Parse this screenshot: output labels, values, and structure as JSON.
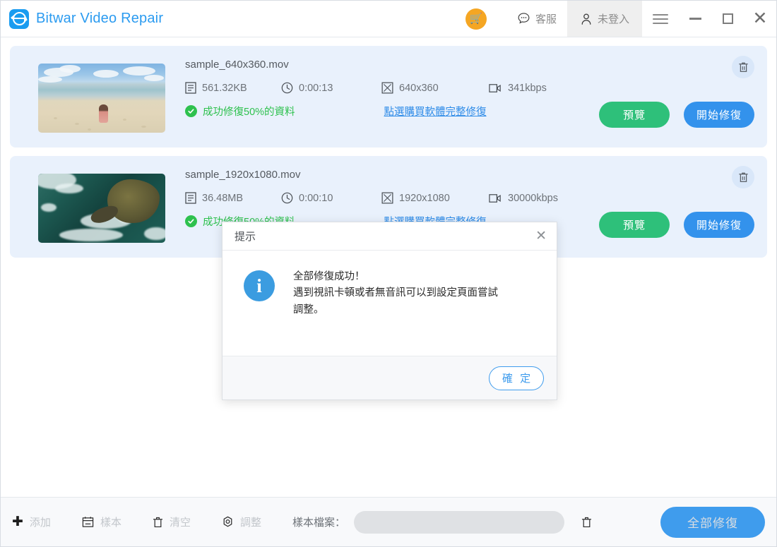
{
  "app": {
    "title": "Bitwar Video Repair",
    "logo_icon": "bitwar-logo-icon"
  },
  "header": {
    "cart_icon": "shopping-cart-icon",
    "support": {
      "icon": "chat-bubble-icon",
      "label": "客服"
    },
    "account": {
      "icon": "person-icon",
      "label": "未登入"
    },
    "menu_icon": "hamburger-menu-icon",
    "minimize_icon": "minimize-icon",
    "maximize_icon": "maximize-icon",
    "close_icon": "close-icon"
  },
  "files": [
    {
      "name": "sample_640x360.mov",
      "size": "561.32KB",
      "duration": "0:00:13",
      "resolution": "640x360",
      "bitrate": "341kbps",
      "status": "成功修復50%的資料",
      "buy_link": "點選購買軟體完整修復",
      "preview_label": "預覽",
      "repair_label": "開始修復",
      "delete_icon": "trash-icon",
      "size_icon": "file-size-icon",
      "duration_icon": "clock-icon",
      "resolution_icon": "resolution-icon",
      "bitrate_icon": "bitrate-camera-icon",
      "status_icon": "check-circle-icon",
      "thumbnail": "beach-photo"
    },
    {
      "name": "sample_1920x1080.mov",
      "size": "36.48MB",
      "duration": "0:00:10",
      "resolution": "1920x1080",
      "bitrate": "30000kbps",
      "status": "成功修復50%的資料",
      "buy_link": "點選購買軟體完整修復",
      "preview_label": "預覽",
      "repair_label": "開始修復",
      "delete_icon": "trash-icon",
      "size_icon": "file-size-icon",
      "duration_icon": "clock-icon",
      "resolution_icon": "resolution-icon",
      "bitrate_icon": "bitrate-camera-icon",
      "status_icon": "check-circle-icon",
      "thumbnail": "ocean-rock-photo"
    }
  ],
  "footer": {
    "add": {
      "icon": "plus-icon",
      "label": "添加"
    },
    "sample": {
      "icon": "sample-file-icon",
      "label": "樣本"
    },
    "clear": {
      "icon": "trash-icon",
      "label": "清空"
    },
    "adjust": {
      "icon": "gear-icon",
      "label": "調整"
    },
    "sample_file_label": "樣本檔案：",
    "sample_file_value": "",
    "sample_file_placeholder": "",
    "sample_delete_icon": "trash-icon",
    "repair_all_label": "全部修復"
  },
  "dialog": {
    "title": "提示",
    "close_icon": "close-icon",
    "info_icon": "info-icon",
    "info_glyph": "i",
    "message": "全部修復成功！\n遇到視訊卡頓或者無音訊可以到設定頁面嘗試調整。",
    "ok_label": "確 定"
  },
  "colors": {
    "brand_blue": "#2b9bf0",
    "card_bg": "#e9f1fc",
    "preview_green": "#2ec07a",
    "repair_blue": "#3392ec",
    "status_green": "#2ec14e",
    "cart_orange": "#f5a623"
  }
}
